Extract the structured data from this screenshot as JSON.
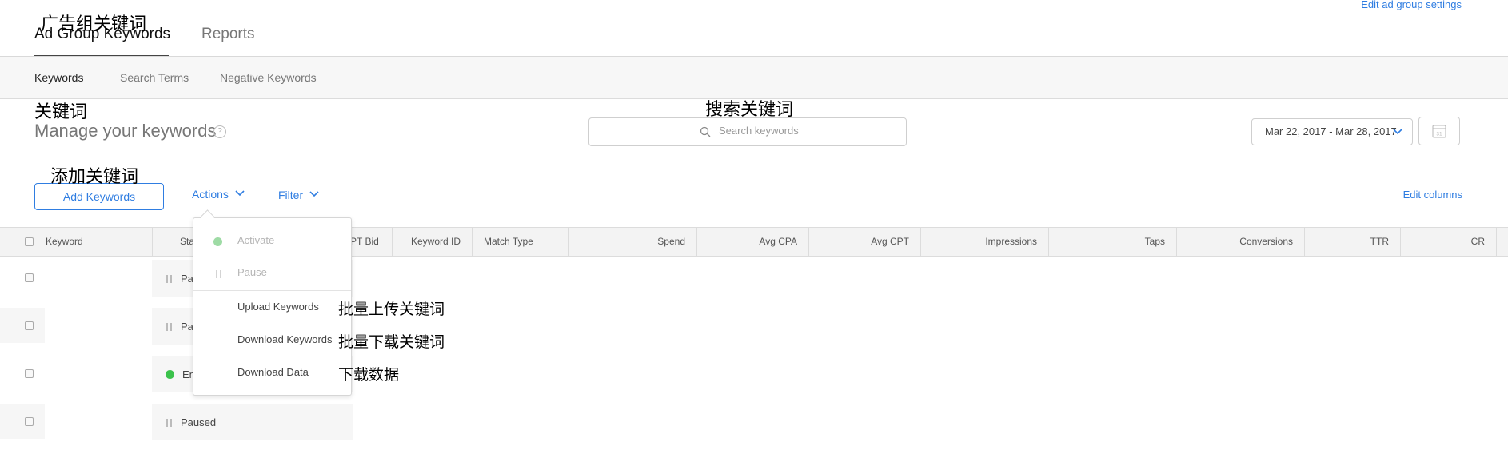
{
  "header": {
    "edit_settings": "Edit ad group settings",
    "tabs": [
      {
        "label": "Ad Group Keywords"
      },
      {
        "label": "Reports"
      }
    ]
  },
  "subnav": {
    "items": [
      {
        "label": "Keywords"
      },
      {
        "label": "Search Terms"
      },
      {
        "label": "Negative Keywords"
      }
    ]
  },
  "manage": {
    "title": "Manage your keywords",
    "help": "?",
    "search_placeholder": "Search keywords",
    "date_range": "Mar 22, 2017 - Mar 28, 2017",
    "calendar_day": "31"
  },
  "toolbar": {
    "add_keywords": "Add Keywords",
    "actions": "Actions",
    "filter": "Filter",
    "edit_columns": "Edit columns"
  },
  "table": {
    "columns": {
      "keyword": "Keyword",
      "status": "Sta",
      "cpt_bid": "PT Bid",
      "keyword_id": "Keyword ID",
      "match_type": "Match Type",
      "spend": "Spend",
      "avg_cpa": "Avg CPA",
      "avg_cpt": "Avg CPT",
      "impressions": "Impressions",
      "taps": "Taps",
      "conversions": "Conversions",
      "ttr": "TTR",
      "cr": "CR"
    },
    "rows": [
      {
        "status": "Pa",
        "state": "paused"
      },
      {
        "status": "Pa",
        "state": "paused"
      },
      {
        "status": "En",
        "state": "enabled"
      },
      {
        "status": "Paused",
        "state": "paused"
      }
    ]
  },
  "actions_menu": {
    "activate": "Activate",
    "pause": "Pause",
    "upload": "Upload Keywords",
    "download_keywords": "Download Keywords",
    "download_data": "Download Data"
  },
  "annotations": {
    "ad_group_keywords": "广告组关键词",
    "keywords": "关键词",
    "search_keywords": "搜索关键词",
    "add_keywords": "添加关键词",
    "bulk_upload": "批量上传关键词",
    "bulk_download": "批量下载关键词",
    "download_data": "下载数据"
  },
  "colors": {
    "accent": "#2f7de1",
    "enabled": "#3bc24b",
    "header_bg": "#f3f3f3"
  }
}
